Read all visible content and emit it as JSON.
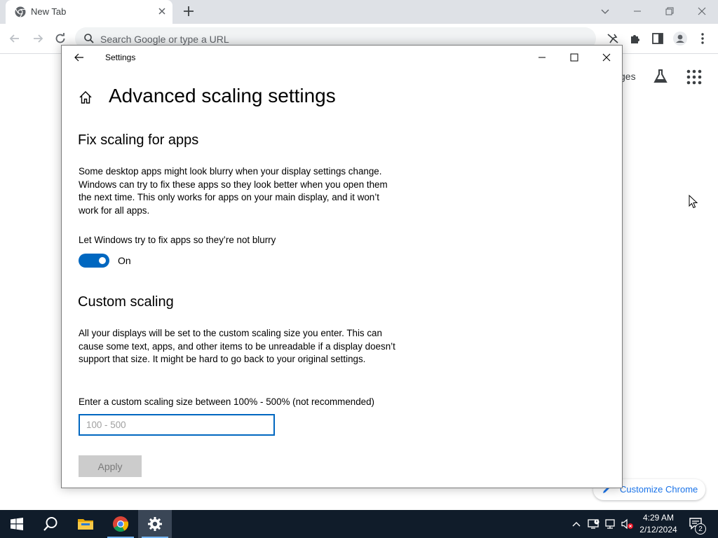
{
  "browser": {
    "tab_title": "New Tab",
    "omnibox_placeholder": "Search Google or type a URL",
    "ntp_partial_link": "ges",
    "customize_label": "Customize Chrome"
  },
  "settings": {
    "window_title": "Settings",
    "page_title": "Advanced scaling settings",
    "fix_section": {
      "heading": "Fix scaling for apps",
      "description": "Some desktop apps might look blurry when your display settings change. Windows can try to fix these apps so they look better when you open them the next time. This only works for apps on your main display, and it won’t work for all apps.",
      "toggle_label": "Let Windows try to fix apps so they’re not blurry",
      "toggle_state": "On"
    },
    "custom_section": {
      "heading": "Custom scaling",
      "description": "All your displays will be set to the custom scaling size you enter. This can cause some text, apps, and other items to be unreadable if a display doesn’t support that size. It might be hard to go back to your original settings.",
      "input_label": "Enter a custom scaling size between 100% - 500% (not recommended)",
      "input_placeholder": "100 - 500",
      "input_value": "",
      "apply_label": "Apply"
    }
  },
  "taskbar": {
    "time": "4:29 AM",
    "date": "2/12/2024",
    "notification_count": "2",
    "apps": [
      "start-icon",
      "search-icon",
      "file-explorer-icon",
      "chrome-icon",
      "settings-gear-icon"
    ]
  },
  "colors": {
    "accent": "#0067c0",
    "taskbar": "#101c2a",
    "chrome_frame": "#dee1e6"
  }
}
